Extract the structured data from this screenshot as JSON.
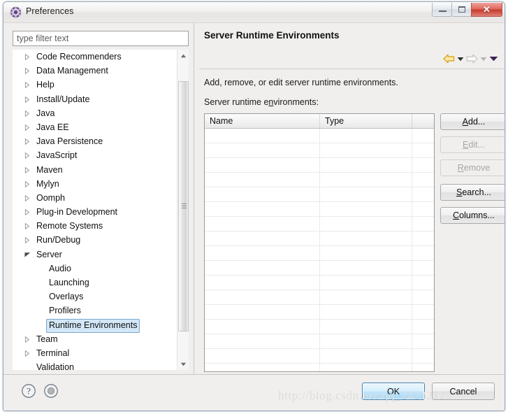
{
  "window": {
    "title": "Preferences",
    "icon": "preferences-gear-icon",
    "controls": {
      "minimize": "minimize-icon",
      "maximize": "maximize-icon",
      "close": "✕"
    }
  },
  "sidebar": {
    "filter": {
      "placeholder": "type filter text",
      "value": ""
    },
    "items": [
      {
        "label": "Code Recommenders",
        "state": "collapsed",
        "level": 0
      },
      {
        "label": "Data Management",
        "state": "collapsed",
        "level": 0
      },
      {
        "label": "Help",
        "state": "collapsed",
        "level": 0
      },
      {
        "label": "Install/Update",
        "state": "collapsed",
        "level": 0
      },
      {
        "label": "Java",
        "state": "collapsed",
        "level": 0
      },
      {
        "label": "Java EE",
        "state": "collapsed",
        "level": 0
      },
      {
        "label": "Java Persistence",
        "state": "collapsed",
        "level": 0
      },
      {
        "label": "JavaScript",
        "state": "collapsed",
        "level": 0
      },
      {
        "label": "Maven",
        "state": "collapsed",
        "level": 0
      },
      {
        "label": "Mylyn",
        "state": "collapsed",
        "level": 0
      },
      {
        "label": "Oomph",
        "state": "collapsed",
        "level": 0
      },
      {
        "label": "Plug-in Development",
        "state": "collapsed",
        "level": 0
      },
      {
        "label": "Remote Systems",
        "state": "collapsed",
        "level": 0
      },
      {
        "label": "Run/Debug",
        "state": "collapsed",
        "level": 0
      },
      {
        "label": "Server",
        "state": "expanded",
        "level": 0
      },
      {
        "label": "Audio",
        "state": "leaf",
        "level": 1
      },
      {
        "label": "Launching",
        "state": "leaf",
        "level": 1
      },
      {
        "label": "Overlays",
        "state": "leaf",
        "level": 1
      },
      {
        "label": "Profilers",
        "state": "leaf",
        "level": 1
      },
      {
        "label": "Runtime Environments",
        "state": "leaf",
        "level": 1,
        "selected": true
      },
      {
        "label": "Team",
        "state": "collapsed",
        "level": 0
      },
      {
        "label": "Terminal",
        "state": "collapsed",
        "level": 0
      },
      {
        "label": "Validation",
        "state": "leaf",
        "level": 0
      }
    ]
  },
  "page": {
    "title": "Server Runtime Environments",
    "description": "Add, remove, or edit server runtime environments.",
    "list_label_pre": "Server runtime e",
    "list_label_mnemonic": "n",
    "list_label_post": "vironments:",
    "nav": {
      "back": "back-arrow-icon",
      "back_menu": "back-dropdown-icon",
      "forward": "forward-arrow-icon",
      "forward_menu": "forward-dropdown-icon",
      "view_menu": "view-menu-icon"
    }
  },
  "table": {
    "columns": [
      {
        "key": "name",
        "label": "Name"
      },
      {
        "key": "type",
        "label": "Type"
      },
      {
        "key": "extra",
        "label": ""
      }
    ],
    "rows": [],
    "empty_row_count": 17
  },
  "buttons": {
    "add": {
      "pre": "",
      "mnemonic": "A",
      "post": "dd...",
      "enabled": true
    },
    "edit": {
      "pre": "",
      "mnemonic": "E",
      "post": "dit...",
      "enabled": false
    },
    "remove": {
      "pre": "",
      "mnemonic": "R",
      "post": "emove",
      "enabled": false
    },
    "search": {
      "pre": "",
      "mnemonic": "S",
      "post": "earch...",
      "enabled": true
    },
    "columns": {
      "pre": "",
      "mnemonic": "C",
      "post": "olumns...",
      "enabled": true
    }
  },
  "footer": {
    "help_icon": "question-mark-icon",
    "dot_icon": "circle-dot-icon",
    "ok_label": "OK",
    "cancel_label": "Cancel"
  },
  "watermark": "http://blog.csdn.net/qq_24232123",
  "colors": {
    "selection_bg": "#d3e7f7",
    "selection_border": "#7aa7d0",
    "primary_button_border": "#3c7fb1",
    "close_button": "#c63b2c",
    "back_arrow": "#e8a317",
    "forward_arrow": "#c9c9c9",
    "view_menu": "#4b2a6b",
    "dialog_bg": "#f0efee"
  }
}
